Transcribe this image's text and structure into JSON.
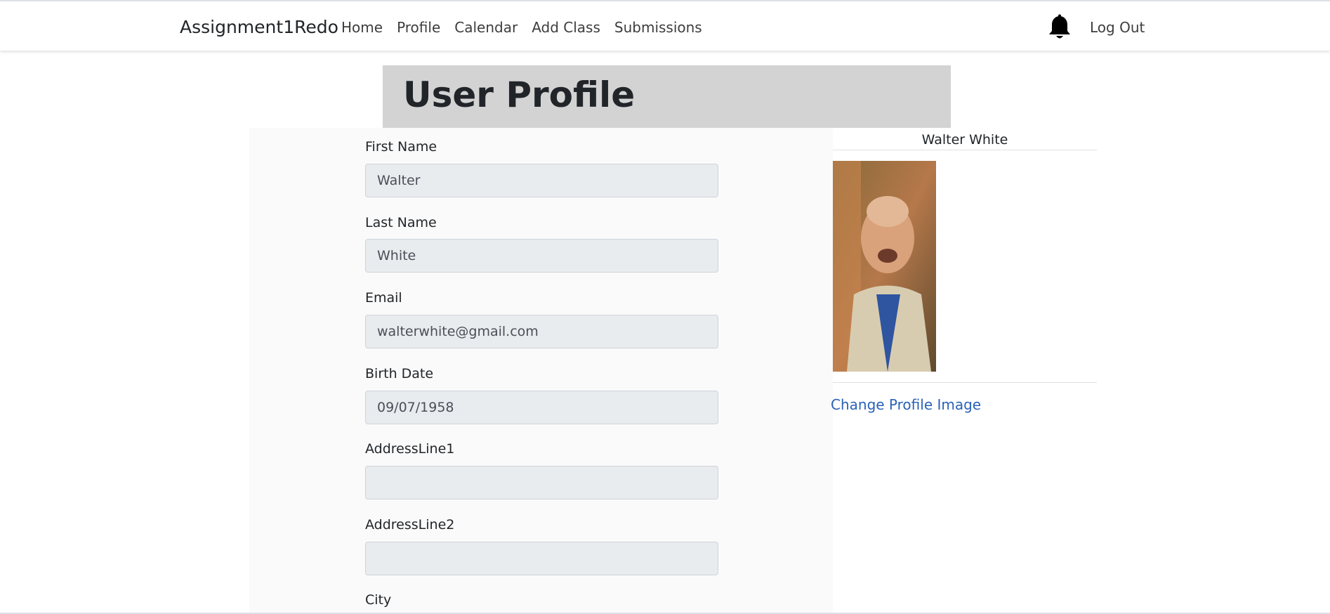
{
  "navbar": {
    "brand": "Assignment1Redo",
    "links": [
      "Home",
      "Profile",
      "Calendar",
      "Add Class",
      "Submissions"
    ],
    "notification_icon": "bell-icon",
    "logout_label": "Log Out"
  },
  "header": {
    "title": "User Profile"
  },
  "form": {
    "fields": [
      {
        "label": "First Name",
        "value": "Walter"
      },
      {
        "label": "Last Name",
        "value": "White"
      },
      {
        "label": "Email",
        "value": "walterwhite@gmail.com"
      },
      {
        "label": "Birth Date",
        "value": "09/07/1958"
      },
      {
        "label": "AddressLine1",
        "value": ""
      },
      {
        "label": "AddressLine2",
        "value": ""
      },
      {
        "label": "City",
        "value": ""
      }
    ]
  },
  "profile": {
    "name": "Walter White",
    "change_image_label": "Change Profile Image"
  },
  "colors": {
    "header_bg": "#d3d3d3",
    "input_bg": "#e9ecef",
    "link": "#2a62b8"
  }
}
